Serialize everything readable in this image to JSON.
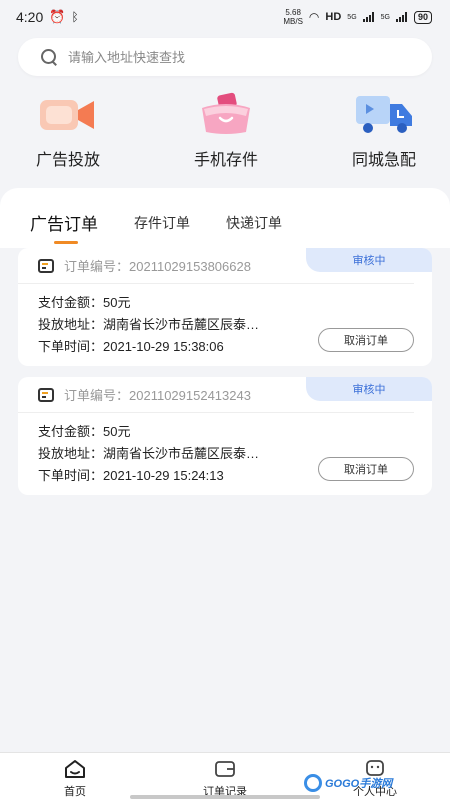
{
  "status_bar": {
    "time": "4:20",
    "net_speed_value": "5.68",
    "net_speed_unit": "MB/S",
    "hd": "HD",
    "signal_1": "5G",
    "signal_2": "5G",
    "battery": "90"
  },
  "search": {
    "placeholder": "请输入地址快速查找"
  },
  "quick_nav": [
    {
      "label": "广告投放",
      "icon": "camera-icon"
    },
    {
      "label": "手机存件",
      "icon": "bag-icon"
    },
    {
      "label": "同城急配",
      "icon": "delivery-truck-icon"
    }
  ],
  "tabs": [
    {
      "label": "广告订单",
      "active": true
    },
    {
      "label": "存件订单",
      "active": false
    },
    {
      "label": "快递订单",
      "active": false
    }
  ],
  "orders": [
    {
      "order_no_label": "订单编号：",
      "order_no": "20211029153806628",
      "status": "审核中",
      "amount_label": "支付金额：",
      "amount": "50元",
      "address_label": "投放地址：",
      "address": "湖南省长沙市岳麓区辰泰…",
      "time_label": "下单时间：",
      "time": "2021-10-29 15:38:06",
      "action": "取消订单"
    },
    {
      "order_no_label": "订单编号：",
      "order_no": "20211029152413243",
      "status": "审核中",
      "amount_label": "支付金额：",
      "amount": "50元",
      "address_label": "投放地址：",
      "address": "湖南省长沙市岳麓区辰泰…",
      "time_label": "下单时间：",
      "time": "2021-10-29 15:24:13",
      "action": "取消订单"
    }
  ],
  "bottom_nav": [
    {
      "label": "首页",
      "icon": "home-icon"
    },
    {
      "label": "订单记录",
      "icon": "wallet-icon"
    },
    {
      "label": "个人中心",
      "icon": "user-icon"
    }
  ],
  "watermark": {
    "text": "GOGO手游网"
  },
  "colors": {
    "accent": "#f08a24",
    "status_badge_bg": "#dfe9fb",
    "status_badge_text": "#3a6fd8",
    "background": "#f3f4f7"
  }
}
